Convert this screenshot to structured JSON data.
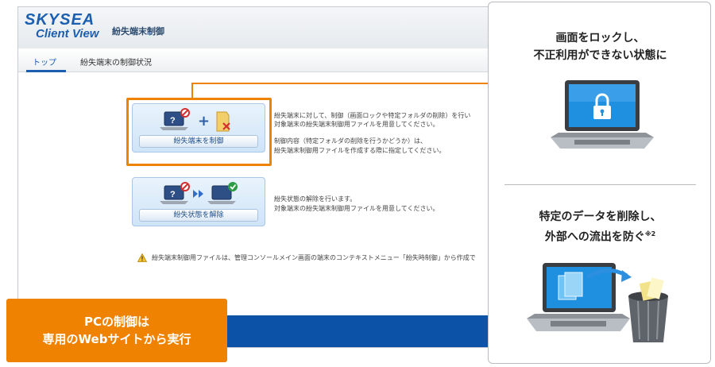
{
  "app": {
    "logo_top": "SKYSEA",
    "logo_bottom": "Client View",
    "title": "紛失端末制御",
    "tabs": [
      {
        "label": "トップ",
        "active": true
      },
      {
        "label": "紛失端末の制御状況",
        "active": false
      }
    ],
    "actions": [
      {
        "label": "紛失端末を制御",
        "description": [
          "紛失端末に対して、制御（画面ロックや特定フォルダの削除）を行い",
          "対象端末の紛失端末制御用ファイルを用意してください。",
          "",
          "制御内容（特定フォルダの削除を行うかどうか）は、",
          "紛失端末制御用ファイルを作成する際に指定してください。"
        ]
      },
      {
        "label": "紛失状態を解除",
        "description": [
          "紛失状態の解除を行います。",
          "対象端末の紛失端末制御用ファイルを用意してください。"
        ]
      }
    ],
    "warning": "紛失端末制御用ファイルは、管理コンソールメイン画面の端末のコンテキストメニュー「紛失時制御」から作成で"
  },
  "callout": {
    "line1": "PCの制御は",
    "line2": "専用のWebサイトから実行",
    "color": "#ef8200"
  },
  "features": [
    {
      "line1": "画面をロックし、",
      "line2": "不正利用ができない状態に",
      "icon": "laptop-lock-icon"
    },
    {
      "line1": "特定のデータを削除し、",
      "line2": "外部への流出を防ぐ",
      "note": "※2",
      "icon": "laptop-trash-icon"
    }
  ],
  "colors": {
    "accent": "#ef8200",
    "brand": "#1c5fb0",
    "footer": "#0c52a6"
  }
}
